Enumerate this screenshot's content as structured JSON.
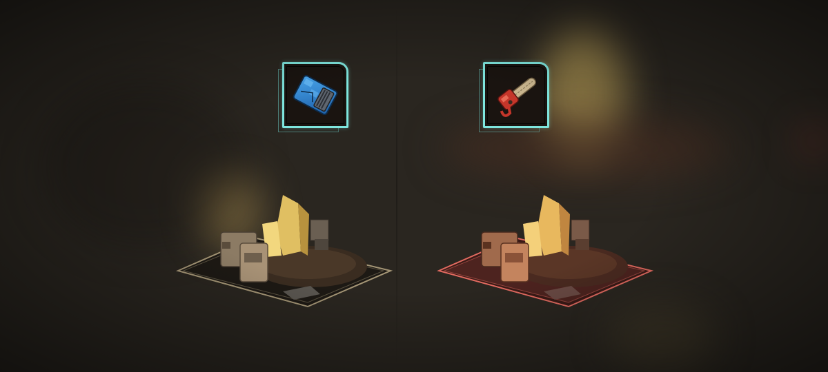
{
  "scene": {
    "background_color": "#2a2620",
    "accent_color": "#7ee6de",
    "left_plate_border_color": "#a59676",
    "right_plate_border_color": "#e26a60"
  },
  "items": [
    {
      "icon": "blue-armor-plate-icon",
      "color": "#2f86d6"
    },
    {
      "icon": "chainsaw-icon",
      "color": "#c5362a"
    }
  ],
  "buildings": [
    {
      "name": "gold-mine-building",
      "state": "normal"
    },
    {
      "name": "gold-mine-building",
      "state": "highlighted-red"
    }
  ]
}
